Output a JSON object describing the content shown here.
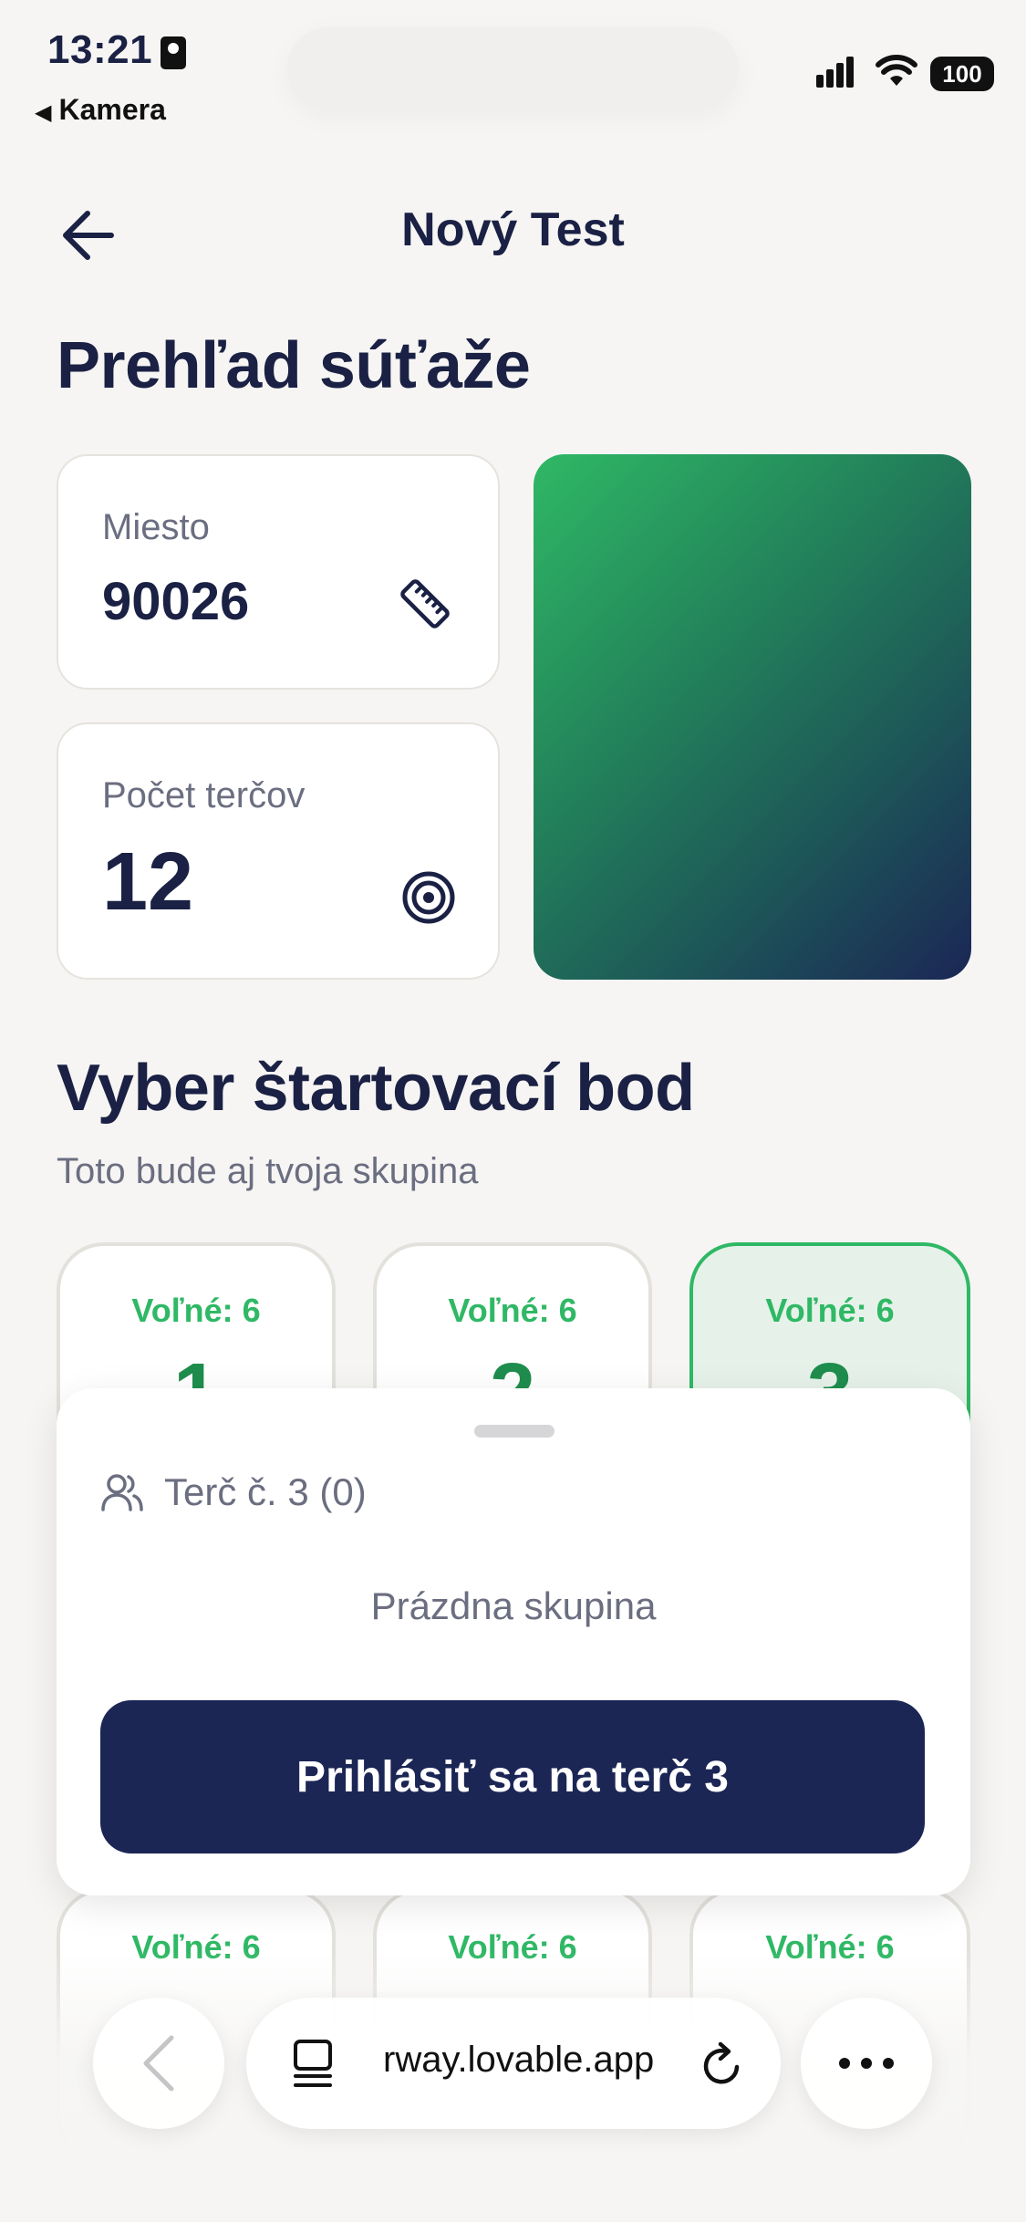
{
  "status_bar": {
    "time": "13:21",
    "back_app": "Kamera",
    "battery": "100"
  },
  "header": {
    "title": "Nový Test"
  },
  "overview": {
    "heading": "Prehľad súťaže",
    "place_label": "Miesto",
    "place_value": "90026",
    "targets_label": "Počet terčov",
    "targets_value": "12"
  },
  "start_point": {
    "heading": "Vyber štartovací bod",
    "subheading": "Toto bude aj tvoja skupina",
    "tiles_top": [
      {
        "free": "Voľné: 6",
        "number": "1",
        "selected": false
      },
      {
        "free": "Voľné: 6",
        "number": "2",
        "selected": false
      },
      {
        "free": "Voľné: 6",
        "number": "3",
        "selected": true
      }
    ],
    "tiles_bottom": [
      {
        "free": "Voľné: 6"
      },
      {
        "free": "Voľné: 6"
      },
      {
        "free": "Voľné: 6"
      }
    ]
  },
  "sheet": {
    "group_title": "Terč č. 3 (0)",
    "empty_text": "Prázdna skupina",
    "cta_label": "Prihlásiť sa na terč 3"
  },
  "browser": {
    "url": "rway.lovable.app"
  },
  "colors": {
    "navy": "#1b2655",
    "green": "#2fb865",
    "background": "#f6f5f3"
  }
}
